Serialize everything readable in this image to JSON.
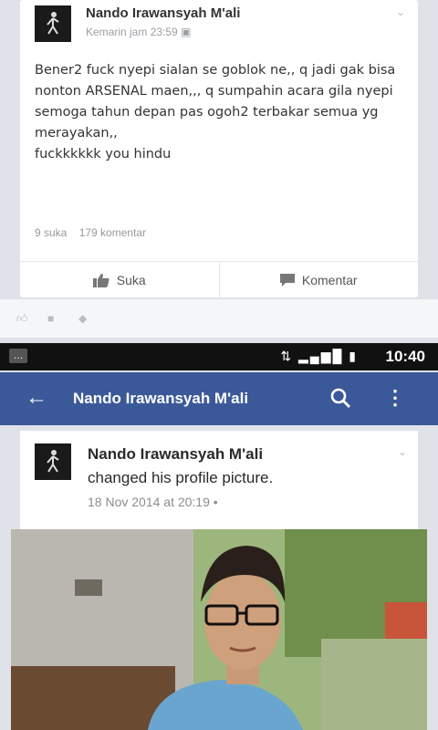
{
  "post1": {
    "author": "Nando Irawansyah M'ali",
    "time": "Kemarin jam 23:59",
    "body": "Bener2 fuck nyepi sialan se goblok ne,, q jadi gak bisa nonton ARSENAL maen,,, q sumpahin acara gila nyepi semoga tahun depan pas ogoh2 terbakar semua yg merayakan,,\nfuckkkkkk you hindu",
    "likes": "9 suka",
    "comments": "179 komentar",
    "like_label": "Suka",
    "comment_label": "Komentar"
  },
  "statusbar": {
    "time": "10:40"
  },
  "appbar": {
    "title": "Nando Irawansyah M'ali"
  },
  "post2": {
    "author": "Nando Irawansyah M'ali",
    "action": "changed his profile picture.",
    "time": "18 Nov 2014 at 20:19"
  },
  "colors": {
    "facebook_blue": "#3b5998",
    "status_bar": "#111111",
    "card": "#ffffff"
  },
  "icons": [
    "thumbs-up-icon",
    "comment-icon",
    "tag-icon",
    "back-arrow-icon",
    "search-icon",
    "more-vert-icon",
    "chevron-down-icon",
    "globe-icon",
    "signal-icon",
    "battery-icon"
  ]
}
